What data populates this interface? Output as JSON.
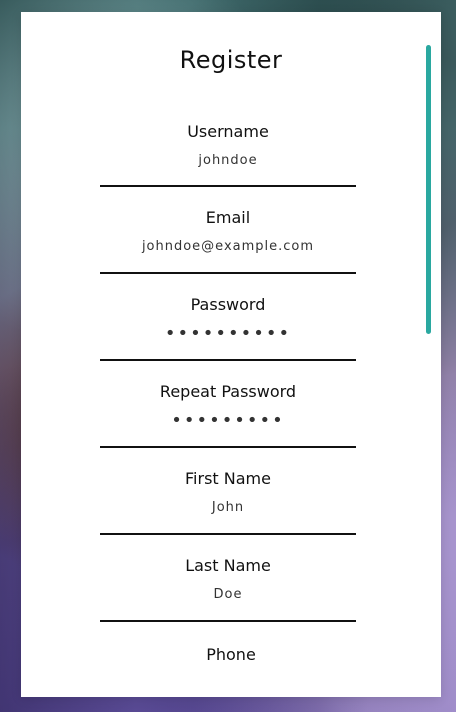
{
  "form": {
    "title": "Register",
    "fields": [
      {
        "label": "Username",
        "value": "johndoe"
      },
      {
        "label": "Email",
        "value": "johndoe@example.com"
      },
      {
        "label": "Password",
        "value": "••••••••••"
      },
      {
        "label": "Repeat Password",
        "value": "•••••••••"
      },
      {
        "label": "First Name",
        "value": "John"
      },
      {
        "label": "Last Name",
        "value": "Doe"
      },
      {
        "label": "Phone",
        "value": ""
      }
    ]
  },
  "colors": {
    "accent": "#2aa8a0",
    "card_bg": "#ffffff",
    "text": "#111111"
  }
}
